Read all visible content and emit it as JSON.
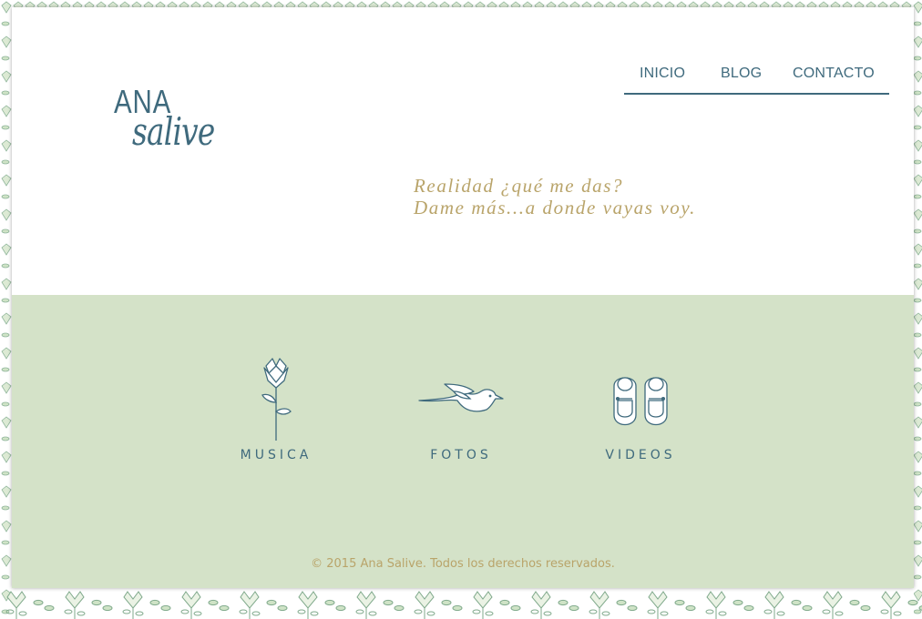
{
  "site": {
    "logo": {
      "line1": "ANA",
      "line2": "salive"
    }
  },
  "nav": {
    "items": [
      {
        "label": "INICIO"
      },
      {
        "label": "BLOG"
      },
      {
        "label": "CONTACTO"
      }
    ]
  },
  "hero": {
    "tagline_line1": "Realidad ¿qué me das?",
    "tagline_line2": "Dame más...a donde vayas voy."
  },
  "features": [
    {
      "label": "MUSICA",
      "icon": "flower-icon"
    },
    {
      "label": "FOTOS",
      "icon": "bird-icon"
    },
    {
      "label": "VIDEOS",
      "icon": "shoes-icon"
    }
  ],
  "footer": {
    "text": "© 2015 Ana Salive. Todos los derechos reservados."
  },
  "colors": {
    "primary": "#3f6a7d",
    "accent": "#b9a46a",
    "panel": "#d4e2c8",
    "pattern_leaf": "#9dc39a"
  }
}
